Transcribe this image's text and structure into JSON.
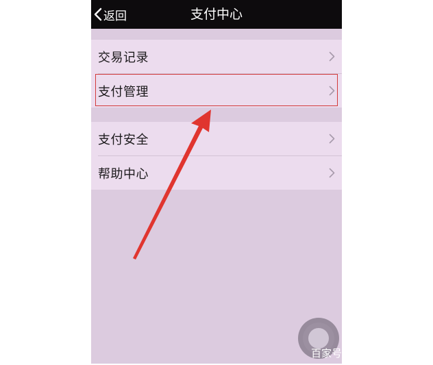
{
  "navbar": {
    "back_label": "返回",
    "title": "支付中心"
  },
  "menu": {
    "group1": [
      {
        "label": "交易记录"
      },
      {
        "label": "支付管理",
        "highlighted": true
      }
    ],
    "group2": [
      {
        "label": "支付安全"
      },
      {
        "label": "帮助中心"
      }
    ]
  },
  "watermark": "百家号",
  "colors": {
    "navbar_bg": "#0d0b0d",
    "background": "#dccbdf",
    "row_bg": "#ecdcee",
    "highlight_border": "#d23a3a",
    "arrow": "#e0352f"
  },
  "icons": {
    "back": "chevron-left-icon",
    "row": "chevron-right-icon",
    "assistive_touch": "assistive-touch-icon",
    "annotation": "red-arrow-annotation"
  }
}
